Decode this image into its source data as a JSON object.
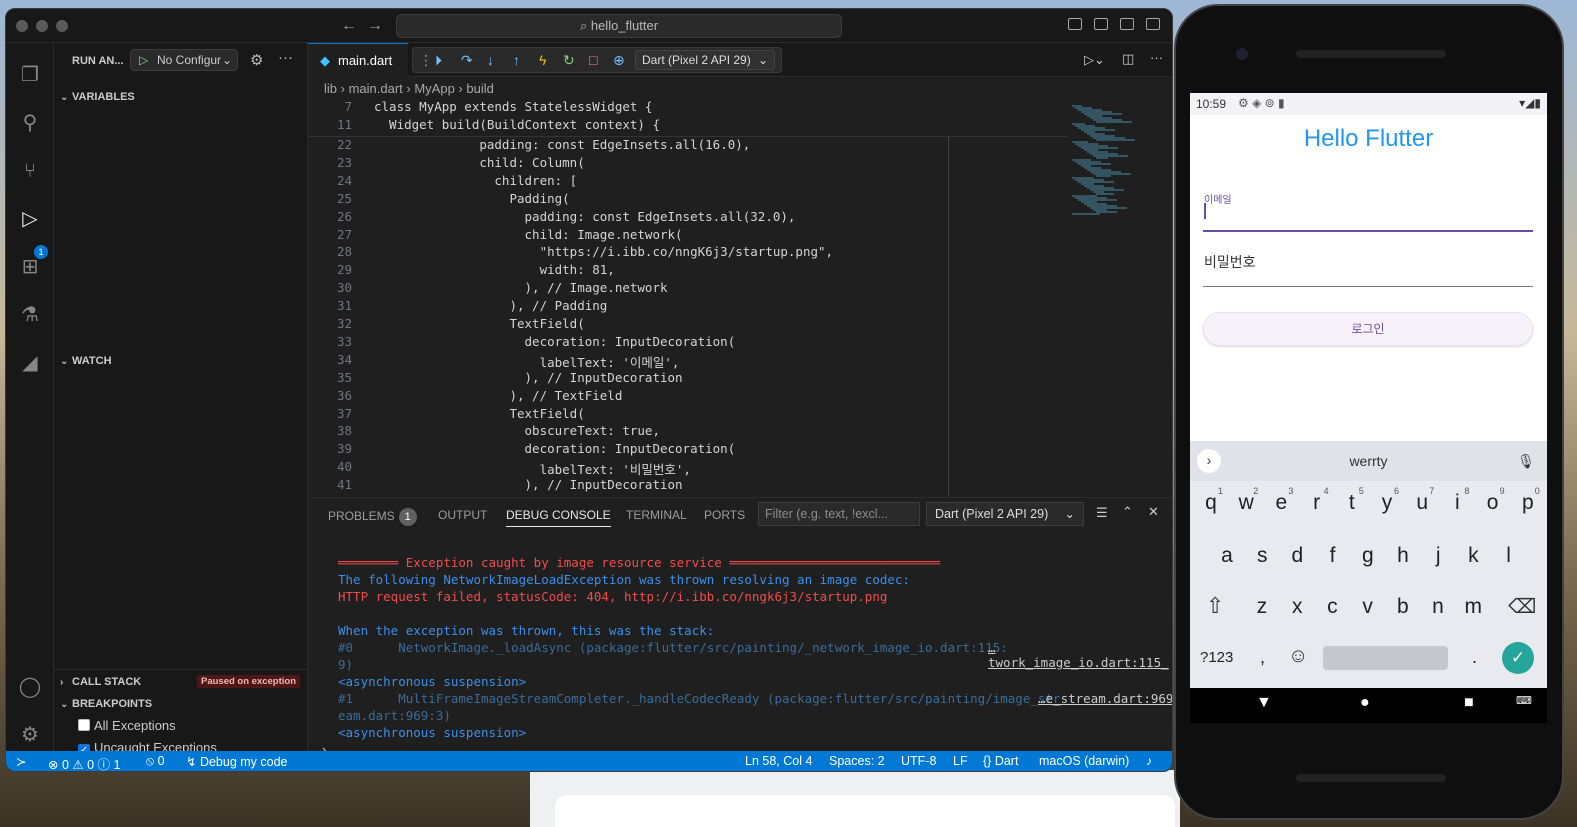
{
  "vscode": {
    "window_title": "hello_flutter",
    "activity": {
      "explorer": "files-icon",
      "search": "search-icon",
      "scm": "source-control-icon",
      "debug": "run-debug-icon",
      "debug_badge": "1",
      "extensions": "extensions-icon",
      "testing": "flask-icon",
      "flutter": "flutter-icon",
      "account": "account-icon",
      "settings": "gear-icon"
    },
    "sidebar": {
      "title": "RUN AN...",
      "config": "No Configur",
      "variables": "VARIABLES",
      "watch": "WATCH",
      "call_stack": "CALL STACK",
      "paused": "Paused on exception",
      "breakpoints": "BREAKPOINTS",
      "bp_items": [
        {
          "label": "All Exceptions",
          "checked": false
        },
        {
          "label": "Uncaught Exceptions",
          "checked": true
        }
      ]
    },
    "editor": {
      "tab": "main.dart",
      "device": "Dart (Pixel 2 API 29)",
      "breadcrumb": [
        "lib",
        "main.dart",
        "MyApp",
        "build"
      ],
      "sticky": [
        {
          "n": "7",
          "code": "class MyApp extends StatelessWidget {"
        },
        {
          "n": "11",
          "code": "  Widget build(BuildContext context) {"
        }
      ],
      "lines": [
        {
          "n": "22",
          "code": "              padding: const EdgeInsets.all(16.0),"
        },
        {
          "n": "23",
          "code": "              child: Column("
        },
        {
          "n": "24",
          "code": "                children: ["
        },
        {
          "n": "25",
          "code": "                  Padding("
        },
        {
          "n": "26",
          "code": "                    padding: const EdgeInsets.all(32.0),"
        },
        {
          "n": "27",
          "code": "                    child: Image.network("
        },
        {
          "n": "28",
          "code": "                      \"https://i.ibb.co/nngK6j3/startup.png\","
        },
        {
          "n": "29",
          "code": "                      width: 81,"
        },
        {
          "n": "30",
          "code": "                    ), // Image.network"
        },
        {
          "n": "31",
          "code": "                  ), // Padding"
        },
        {
          "n": "32",
          "code": "                  TextField("
        },
        {
          "n": "33",
          "code": "                    decoration: InputDecoration("
        },
        {
          "n": "34",
          "code": "                      labelText: '이메일',"
        },
        {
          "n": "35",
          "code": "                    ), // InputDecoration"
        },
        {
          "n": "36",
          "code": "                  ), // TextField"
        },
        {
          "n": "37",
          "code": "                  TextField("
        },
        {
          "n": "38",
          "code": "                    obscureText: true,"
        },
        {
          "n": "39",
          "code": "                    decoration: InputDecoration("
        },
        {
          "n": "40",
          "code": "                      labelText: '비밀번호',"
        },
        {
          "n": "41",
          "code": "                    ), // InputDecoration"
        }
      ]
    },
    "panel": {
      "tabs": [
        "PROBLEMS",
        "OUTPUT",
        "DEBUG CONSOLE",
        "TERMINAL",
        "PORTS"
      ],
      "problems_count": "1",
      "filter_placeholder": "Filter (e.g. text, !excl...",
      "device": "Dart (Pixel 2 API 29)",
      "output": [
        {
          "cls": "red",
          "text": "════════ Exception caught by image resource service ════════════════════════════"
        },
        {
          "cls": "blue",
          "text": "The following NetworkImageLoadException was thrown resolving an image codec:"
        },
        {
          "cls": "red",
          "text": "HTTP request failed, statusCode: 404, http://i.ibb.co/nngk6j3/startup.png"
        },
        {
          "cls": "blue",
          "text": " "
        },
        {
          "cls": "blue",
          "text": "When the exception was thrown, this was the stack:"
        },
        {
          "cls": "dim",
          "text": "#0      NetworkImage._loadAsync (package:flutter/src/painting/_network_image_io.dart:115:"
        },
        {
          "cls": "dim",
          "text": "9)"
        },
        {
          "cls": "blue",
          "text": "<asynchronous suspension>"
        },
        {
          "cls": "dim",
          "text": "#1      MultiFrameImageStreamCompleter._handleCodecReady (package:flutter/src/painting/image_str"
        },
        {
          "cls": "dim",
          "text": "eam.dart:969:3)"
        },
        {
          "cls": "blue",
          "text": "<asynchronous suspension>"
        }
      ],
      "link0": "…twork_image_io.dart:115_",
      "link1": "…e_stream.dart:969"
    },
    "status": {
      "errors": "0",
      "warnings": "0",
      "info": "1",
      "ports": "0",
      "debug": "Debug my code",
      "position": "Ln 58, Col 4",
      "spaces": "Spaces: 2",
      "encoding": "UTF-8",
      "eol": "LF",
      "language": "Dart",
      "platform": "macOS (darwin)"
    }
  },
  "phone": {
    "time": "10:59",
    "title": "Hello Flutter",
    "email_label": "이메일",
    "password_label": "비밀번호",
    "login": "로그인",
    "suggestion": "werrty",
    "row1": [
      "q",
      "w",
      "e",
      "r",
      "t",
      "y",
      "u",
      "i",
      "o",
      "p"
    ],
    "row1_sup": [
      "1",
      "2",
      "3",
      "4",
      "5",
      "6",
      "7",
      "8",
      "9",
      "0"
    ],
    "row2": [
      "a",
      "s",
      "d",
      "f",
      "g",
      "h",
      "j",
      "k",
      "l"
    ],
    "row3": [
      "z",
      "x",
      "c",
      "v",
      "b",
      "n",
      "m"
    ],
    "sym": "?123",
    "comma": ",",
    "period": "."
  }
}
